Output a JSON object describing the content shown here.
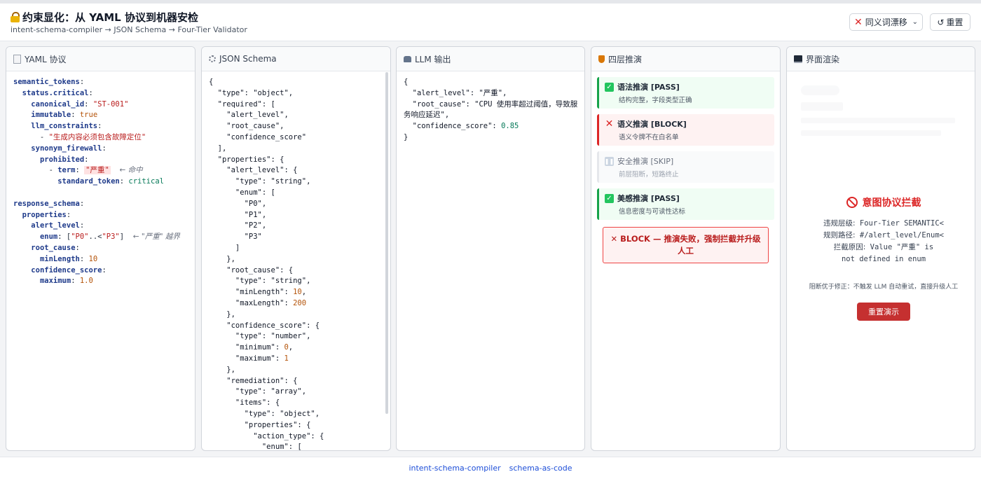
{
  "header": {
    "title": "约束显化：从 YAML 协议到机器安检",
    "subtitle": "intent-schema-compiler → JSON Schema → Four-Tier Validator",
    "mode_select": "同义词漂移",
    "reset_label": "重置"
  },
  "panels": {
    "yaml": {
      "title": "YAML 协议",
      "comment_hit": "← 命中",
      "comment_range": "← \"严重\" 越界"
    },
    "schema": {
      "title": "JSON Schema"
    },
    "llm": {
      "title": "LLM 输出"
    },
    "tiers": {
      "title": "四层推演",
      "steps": [
        {
          "label": "语法推演 [PASS]",
          "desc": "结构完整，字段类型正确",
          "status": "pass"
        },
        {
          "label": "语义推演 [BLOCK]",
          "desc": "语义令牌不在白名单",
          "status": "block"
        },
        {
          "label": "安全推演 [SKIP]",
          "desc": "前层阻断，短路终止",
          "status": "skip"
        },
        {
          "label": "美感推演 [PASS]",
          "desc": "信息密度与可读性达标",
          "status": "pass"
        }
      ],
      "banner": "✕ BLOCK — 推演失败，强制拦截并升级人工"
    },
    "render": {
      "title": "界面渲染",
      "intercept_title": "意图协议拦截",
      "lines": [
        {
          "label": "违规层级:",
          "value": "Four-Tier SEMANTIC<"
        },
        {
          "label": "规则路径:",
          "value": "#/alert_level/Enum<"
        },
        {
          "label": "拦截原因:",
          "value": "Value \"严重\" is not defined in enum"
        }
      ],
      "note": "阻断优于修正：不触发 LLM 自动重试，直接升级人工",
      "replay_label": "重置演示"
    }
  },
  "footer": {
    "links": [
      "intent-schema-compiler",
      "schema-as-code"
    ]
  },
  "colors": {
    "pass": "#16a34a",
    "block": "#dc2626",
    "accent": "#1d4ed8"
  }
}
